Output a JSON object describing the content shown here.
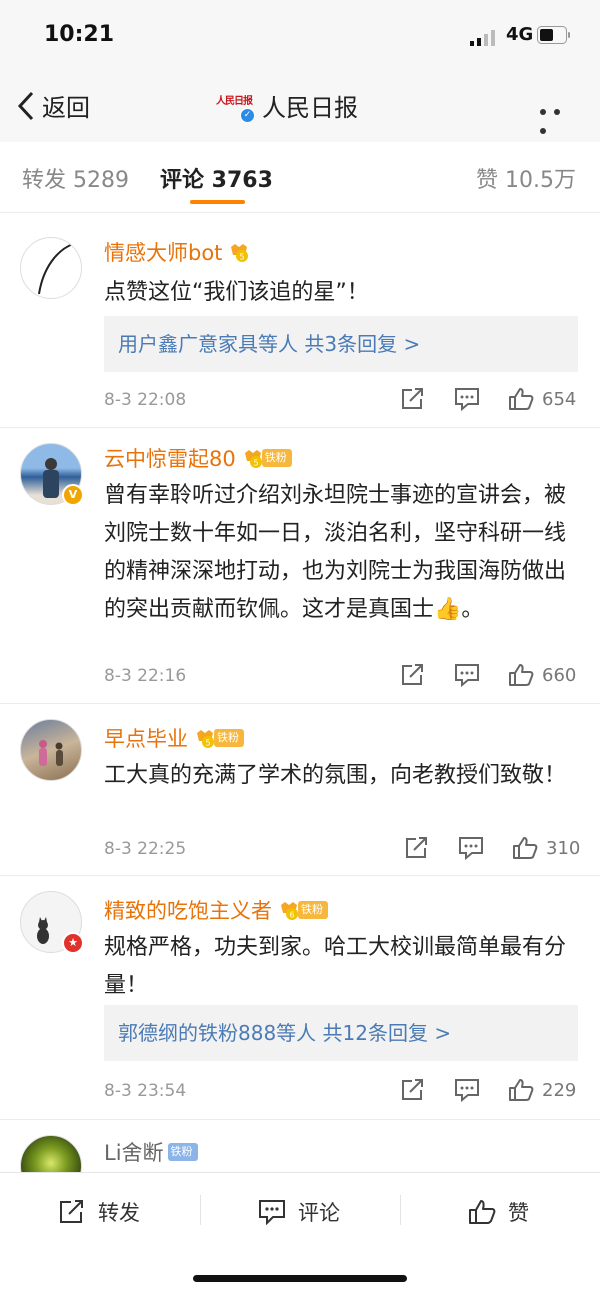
{
  "status": {
    "time": "10:21",
    "network": "4G"
  },
  "nav": {
    "back_label": "返回",
    "title": "人民日报",
    "logo_text": "人民日报"
  },
  "tabs": {
    "repost": "转发 5289",
    "comment": "评论 3763",
    "likes": "赞 10.5万"
  },
  "colors": {
    "accent": "#ff8200",
    "username": "#e8730a",
    "link": "#4b7bb5",
    "badge_blue": "#2b8be6"
  },
  "comments": [
    {
      "username": "情感大师bot",
      "text": "点赞这位“我们该追的星”！",
      "replies": "用户鑫广意家具等人  共3条回复 >",
      "time": "8-3 22:08",
      "likes": "654"
    },
    {
      "username": "云中惊雷起80",
      "badge": "铁粉",
      "text": "曾有幸聆听过介绍刘永坦院士事迹的宣讲会，被刘院士数十年如一日，淡泊名利，坚守科研一线的精神深深地打动，也为刘院士为我国海防做出的突出贡献而钦佩。这才是真国士👍。",
      "time": "8-3 22:16",
      "likes": "660"
    },
    {
      "username": "早点毕业",
      "badge": "铁粉",
      "text": "工大真的充满了学术的氛围，向老教授们致敬！",
      "time": "8-3 22:25",
      "likes": "310"
    },
    {
      "username": "精致的吃饱主义者",
      "badge": "铁粉",
      "text": "规格严格，功夫到家。哈工大校训最简单最有分量！",
      "replies": "郭德纲的铁粉888等人  共12条回复 >",
      "time": "8-3 23:54",
      "likes": "229"
    },
    {
      "username": "Li舍断",
      "badge": "铁粉"
    }
  ],
  "bottom": {
    "repost": "转发",
    "comment": "评论",
    "like": "赞"
  }
}
